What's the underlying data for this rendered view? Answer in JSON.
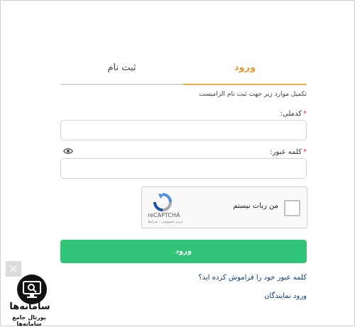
{
  "tabs": {
    "login_label": "ورود",
    "register_label": "ثبت نام"
  },
  "form": {
    "instruction": "تکمیل موارد زیر جهت ثبت نام الزامیست",
    "username_label": "کدملی:",
    "username_value": "",
    "password_label": "کلمه عبور:",
    "password_value": "",
    "required_mark": "*"
  },
  "captcha": {
    "checkbox_label": "من ربات نیستم",
    "brand": "reCAPTCHA",
    "terms": "حریم خصوصی - شرایط"
  },
  "submit_label": "ورود",
  "links": {
    "forgot_password": "کلمه عبور خود را فراموش کرده اید؟",
    "agent_login": "ورود نمایندگان"
  },
  "watermark": {
    "close": "×",
    "name": "سامانه‌ها",
    "subtitle": "پورتال جامع سامانه‌ها"
  },
  "colors": {
    "accent": "#e39a3a",
    "submit": "#2fc476",
    "link": "#0d3c7a"
  }
}
